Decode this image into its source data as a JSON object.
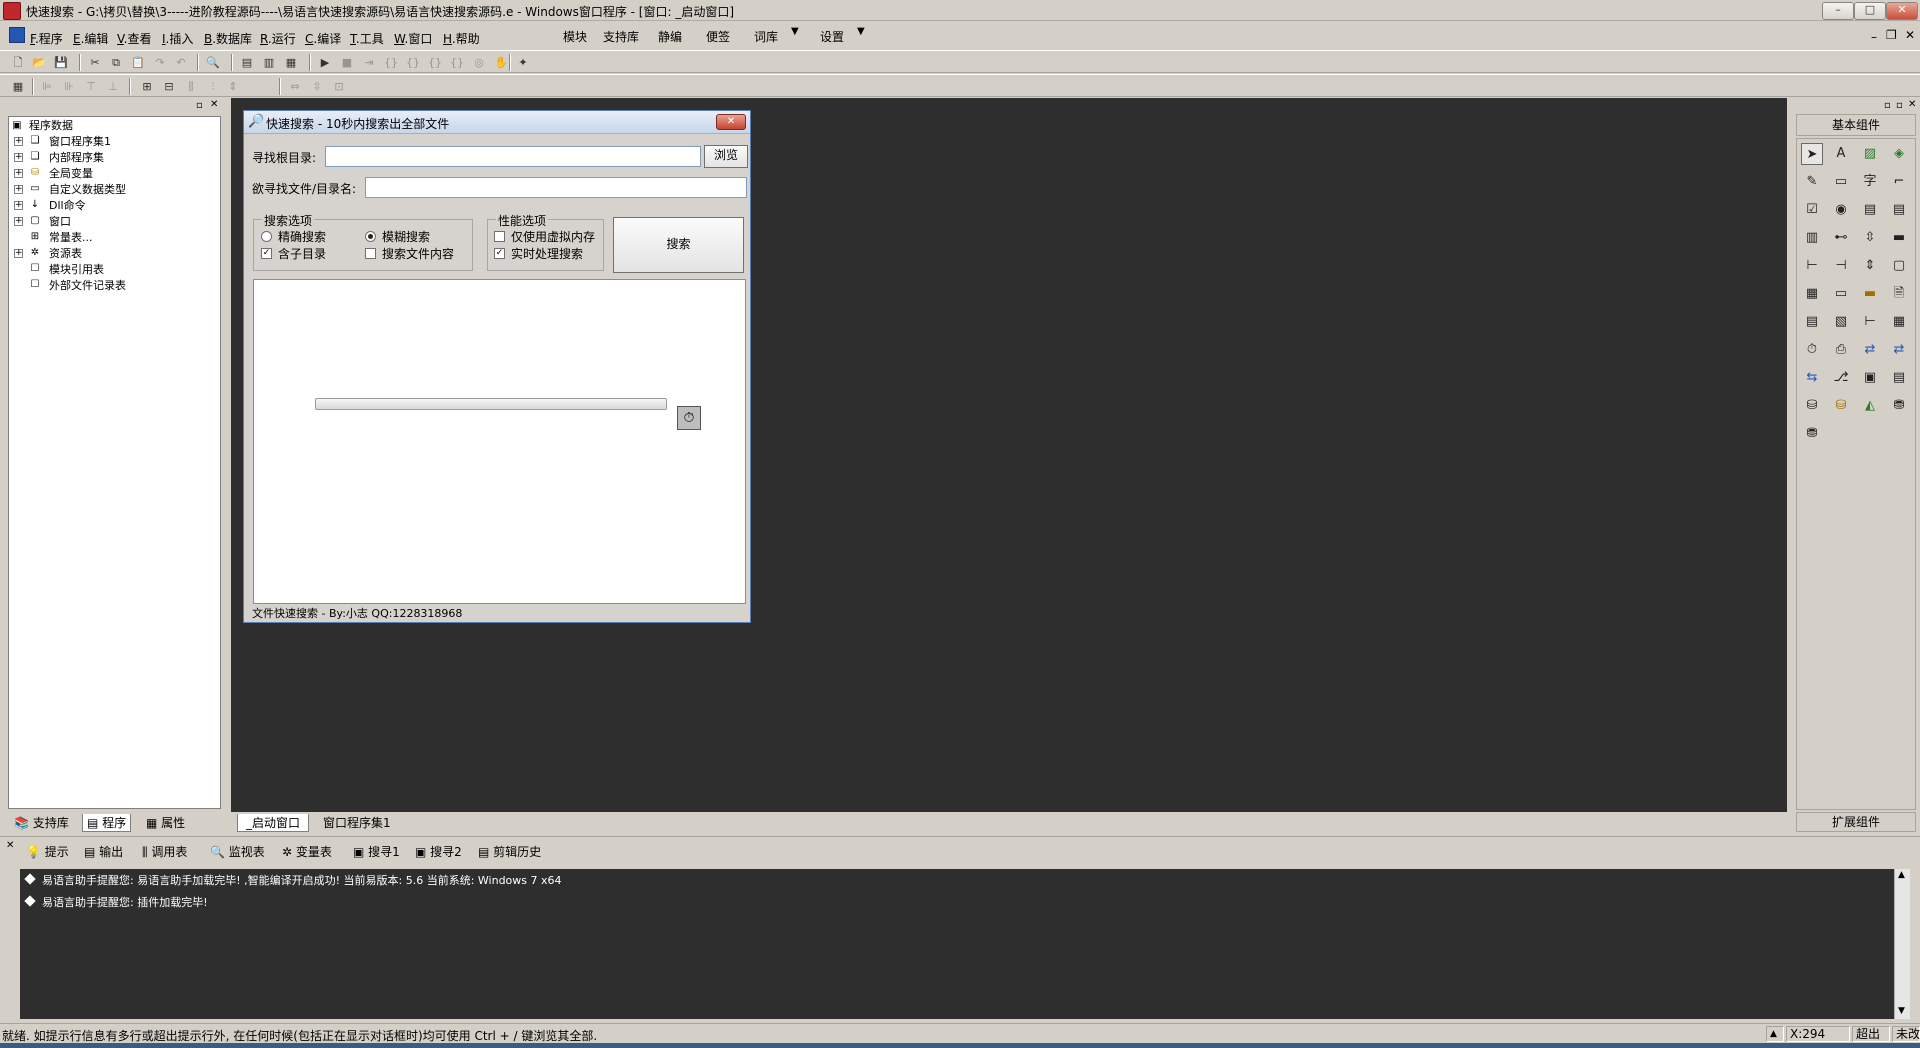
{
  "window": {
    "title": "快速搜索 - G:\\拷贝\\替换\\3-----进阶教程源码----\\易语言快速搜索源码\\易语言快速搜索源码.e - Windows窗口程序 - [窗口: _启动窗口]",
    "min_glyph": "–",
    "max_glyph": "□",
    "close_glyph": "✕"
  },
  "menubar": {
    "items": [
      {
        "key": "F",
        "label": ".程序"
      },
      {
        "key": "E",
        "label": ".编辑"
      },
      {
        "key": "V",
        "label": ".查看"
      },
      {
        "key": "I",
        "label": ".插入"
      },
      {
        "key": "B",
        "label": ".数据库"
      },
      {
        "key": "R",
        "label": ".运行"
      },
      {
        "key": "C",
        "label": ".编译"
      },
      {
        "key": "T",
        "label": ".工具"
      },
      {
        "key": "W",
        "label": ".窗口"
      },
      {
        "key": "H",
        "label": ".帮助"
      }
    ],
    "extras": [
      "模块",
      "支持库",
      "静编",
      "便签",
      "词库",
      "设置"
    ]
  },
  "left_panel": {
    "tree": [
      {
        "label": "程序数据",
        "level": 0
      },
      {
        "label": "窗口程序集1",
        "level": 1
      },
      {
        "label": "内部程序集",
        "level": 1
      },
      {
        "label": "全局变量",
        "level": 1
      },
      {
        "label": "自定义数据类型",
        "level": 1
      },
      {
        "label": "Dll命令",
        "level": 1
      },
      {
        "label": "窗口",
        "level": 1
      },
      {
        "label": "常量表...",
        "level": 1
      },
      {
        "label": "资源表",
        "level": 1
      },
      {
        "label": "模块引用表",
        "level": 1
      },
      {
        "label": "外部文件记录表",
        "level": 1
      }
    ],
    "tabs": [
      "支持库",
      "程序",
      "属性"
    ]
  },
  "designer": {
    "tabs": [
      "_启动窗口",
      "窗口程序集1"
    ],
    "form": {
      "title": "快速搜索 - 10秒内搜索出全部文件",
      "root_label": "寻找根目录:",
      "root_value": "",
      "browse_label": "浏览",
      "name_label": "欲寻找文件/目录名:",
      "name_value": "",
      "group_search_title": "搜索选项",
      "opt_exact": "精确搜索",
      "opt_fuzzy": "模糊搜索",
      "opt_subdir": "含子目录",
      "opt_content": "搜索文件内容",
      "group_perf_title": "性能选项",
      "opt_virtual": "仅使用虚拟内存",
      "opt_realtime": "实时处理搜索",
      "search_button": "搜索",
      "progress": 0,
      "footer": "文件快速搜索 - By:小志   QQ:1228318968"
    }
  },
  "palette": {
    "header": "基本组件",
    "footer": "扩展组件"
  },
  "output": {
    "tabs": [
      "提示",
      "输出",
      "调用表",
      "监视表",
      "变量表",
      "搜寻1",
      "搜寻2",
      "剪辑历史"
    ],
    "lines": [
      "易语言助手提醒您: 易语言助手加载完毕!  ,智能编译开启成功!  当前易版本: 5.6  当前系统: Windows 7 x64",
      "易语言助手提醒您: 插件加载完毕!"
    ]
  },
  "statusbar": {
    "message": "就绪. 如提示行信息有多行或超出提示行外, 在任何时候(包括正在显示对话框时)均可使用 Ctrl + / 键浏览其全部.",
    "coord": "X:294",
    "mode": "超出",
    "state": "未改"
  }
}
